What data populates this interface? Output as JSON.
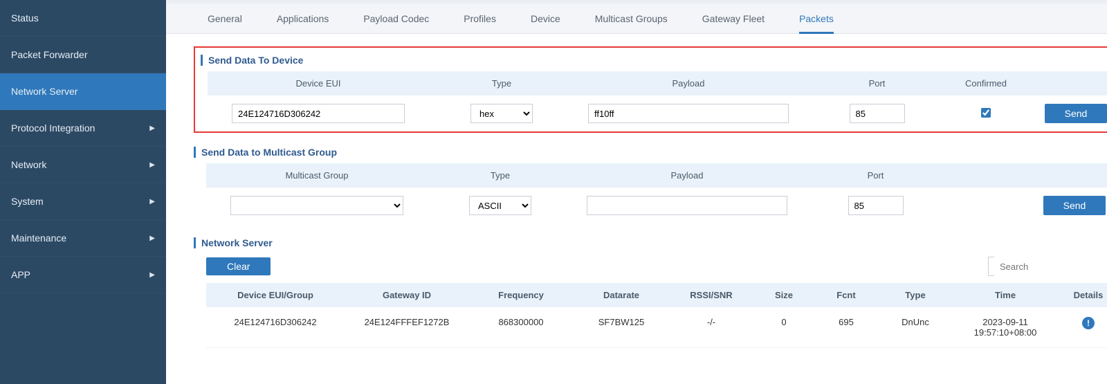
{
  "sidebar": {
    "items": [
      {
        "label": "Status",
        "expandable": false,
        "active": false
      },
      {
        "label": "Packet Forwarder",
        "expandable": false,
        "active": false
      },
      {
        "label": "Network Server",
        "expandable": false,
        "active": true
      },
      {
        "label": "Protocol Integration",
        "expandable": true,
        "active": false
      },
      {
        "label": "Network",
        "expandable": true,
        "active": false
      },
      {
        "label": "System",
        "expandable": true,
        "active": false
      },
      {
        "label": "Maintenance",
        "expandable": true,
        "active": false
      },
      {
        "label": "APP",
        "expandable": true,
        "active": false
      }
    ]
  },
  "tabs": [
    {
      "label": "General",
      "active": false
    },
    {
      "label": "Applications",
      "active": false
    },
    {
      "label": "Payload Codec",
      "active": false
    },
    {
      "label": "Profiles",
      "active": false
    },
    {
      "label": "Device",
      "active": false
    },
    {
      "label": "Multicast Groups",
      "active": false
    },
    {
      "label": "Gateway Fleet",
      "active": false
    },
    {
      "label": "Packets",
      "active": true
    }
  ],
  "sendDevice": {
    "title": "Send Data To Device",
    "headers": {
      "deveui": "Device EUI",
      "type": "Type",
      "payload": "Payload",
      "port": "Port",
      "confirmed": "Confirmed"
    },
    "values": {
      "deveui": "24E124716D306242",
      "type": "hex",
      "payload": "ff10ff",
      "port": "85",
      "confirmed": true
    },
    "sendLabel": "Send"
  },
  "sendMulticast": {
    "title": "Send Data to Multicast Group",
    "headers": {
      "group": "Multicast Group",
      "type": "Type",
      "payload": "Payload",
      "port": "Port"
    },
    "values": {
      "group": "",
      "type": "ASCII",
      "payload": "",
      "port": "85"
    },
    "sendLabel": "Send"
  },
  "networkServer": {
    "title": "Network Server",
    "clearLabel": "Clear",
    "searchPlaceholder": "Search",
    "columns": {
      "dev": "Device EUI/Group",
      "gw": "Gateway ID",
      "freq": "Frequency",
      "dr": "Datarate",
      "rssi": "RSSI/SNR",
      "size": "Size",
      "fcnt": "Fcnt",
      "type": "Type",
      "time": "Time",
      "details": "Details"
    },
    "rows": [
      {
        "dev": "24E124716D306242",
        "gw": "24E124FFFEF1272B",
        "freq": "868300000",
        "dr": "SF7BW125",
        "rssi": "-/-",
        "size": "0",
        "fcnt": "695",
        "type": "DnUnc",
        "time1": "2023-09-11",
        "time2": "19:57:10+08:00"
      }
    ]
  }
}
